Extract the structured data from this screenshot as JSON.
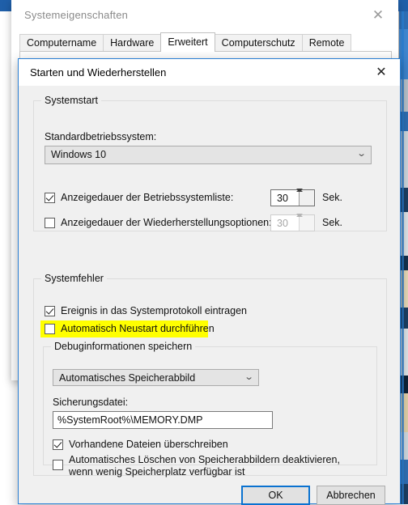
{
  "background_window": {
    "title": "Systemeigenschaften",
    "close_icon": "close-icon",
    "close_glyph": "✕",
    "tabs": [
      {
        "label": "Computername",
        "active": false
      },
      {
        "label": "Hardware",
        "active": false
      },
      {
        "label": "Erweitert",
        "active": true
      },
      {
        "label": "Computerschutz",
        "active": false
      },
      {
        "label": "Remote",
        "active": false
      }
    ]
  },
  "dialog": {
    "title": "Starten und Wiederherstellen",
    "close_icon": "close-icon",
    "close_glyph": "✕",
    "accent_color": "#2a7fd4",
    "startup": {
      "group_label": "Systemstart",
      "default_os_label": "Standardbetriebssystem:",
      "default_os_value": "Windows 10",
      "dropdown_glyph": "⌄",
      "os_list_timeout": {
        "label": "Anzeigedauer der Betriebssystemliste:",
        "checked": true,
        "value": "30",
        "unit": "Sek.",
        "enabled": true
      },
      "recovery_timeout": {
        "label": "Anzeigedauer der Wiederherstellungsoptionen:",
        "checked": false,
        "value": "30",
        "unit": "Sek.",
        "enabled": false
      }
    },
    "system_failure": {
      "group_label": "Systemfehler",
      "write_event": {
        "label": "Ereignis in das Systemprotokoll eintragen",
        "checked": true
      },
      "auto_restart": {
        "label": "Automatisch Neustart durchführen",
        "checked": false,
        "highlighted": true,
        "highlight_color": "#ffff00"
      },
      "debug_info": {
        "group_label": "Debuginformationen speichern",
        "dump_type_value": "Automatisches Speicherabbild",
        "dropdown_glyph": "⌄",
        "dump_file_label": "Sicherungsdatei:",
        "dump_file_value": "%SystemRoot%\\MEMORY.DMP",
        "overwrite": {
          "label": "Vorhandene Dateien überschreiben",
          "checked": true
        },
        "disable_autodelete": {
          "label": "Automatisches Löschen von Speicherabbildern deaktivieren, wenn wenig Speicherplatz verfügbar ist",
          "checked": false
        }
      }
    },
    "buttons": {
      "ok": "OK",
      "cancel": "Abbrechen"
    }
  }
}
